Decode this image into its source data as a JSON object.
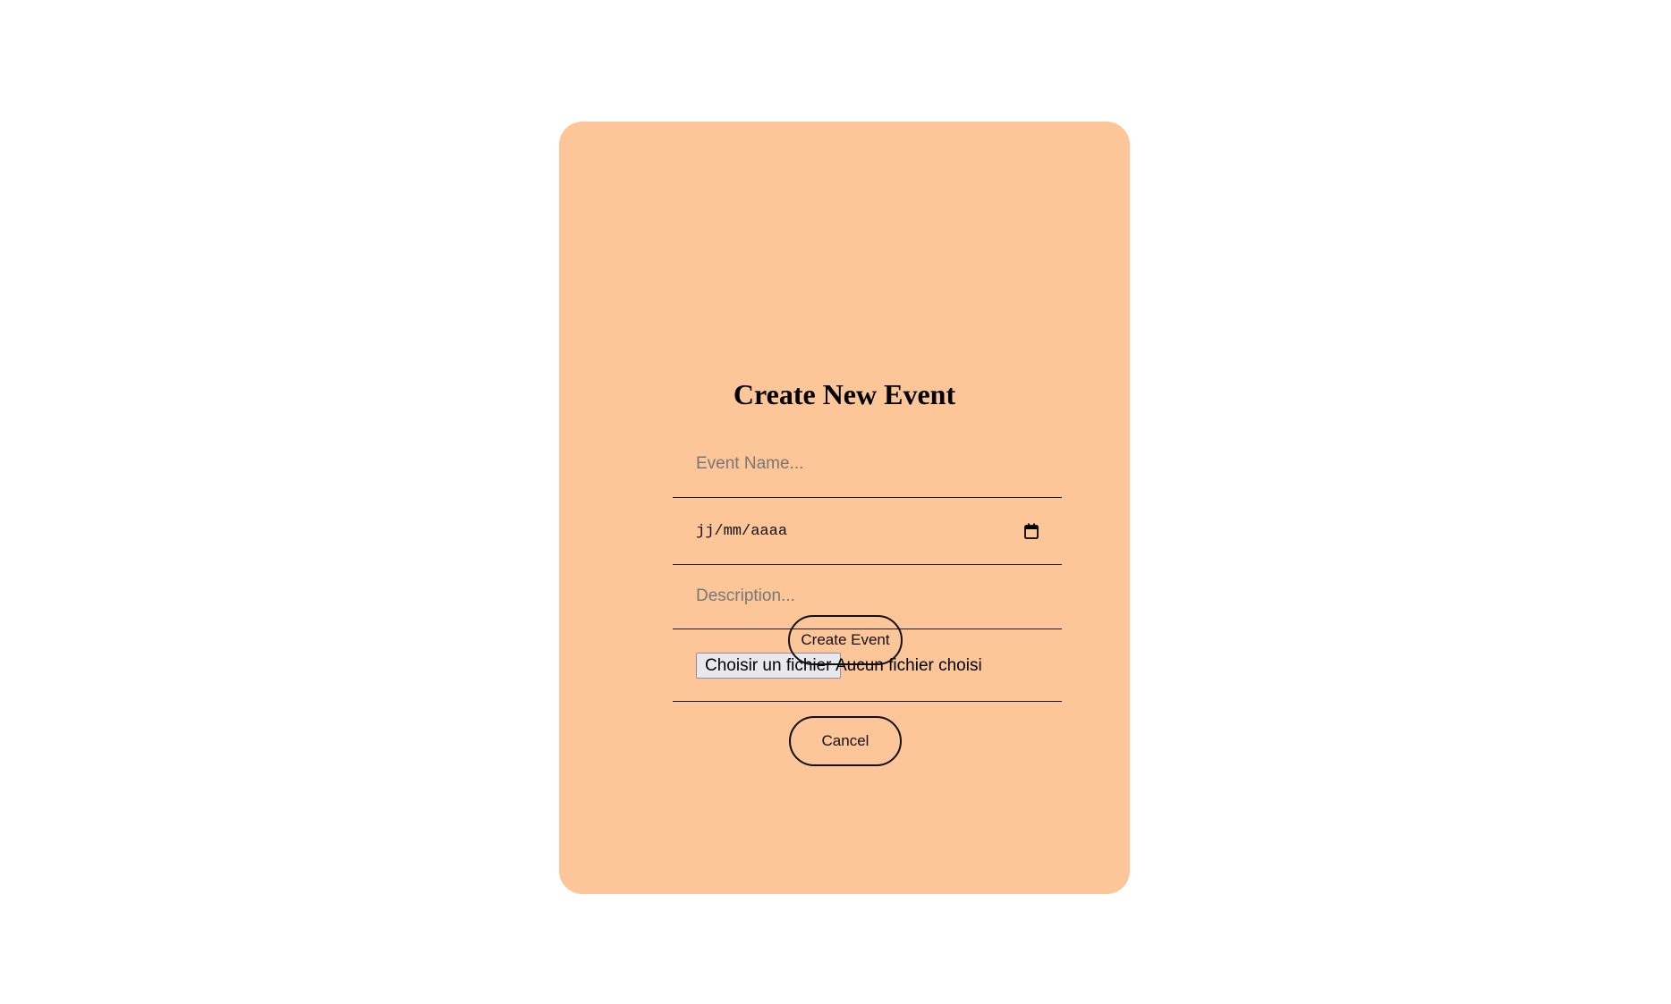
{
  "form": {
    "title": "Create New Event",
    "event_name_placeholder": "Event Name...",
    "date_placeholder": "jj/mm/aaaa",
    "description_placeholder": "Description...",
    "file_button_label": "Choisir un fichier",
    "file_status": "Aucun fichier choisi",
    "create_label": "Create Event",
    "cancel_label": "Cancel"
  },
  "colors": {
    "card_background": "#fdc699",
    "page_background": "#ffffff"
  },
  "icons": {
    "date": "calendar-icon"
  }
}
